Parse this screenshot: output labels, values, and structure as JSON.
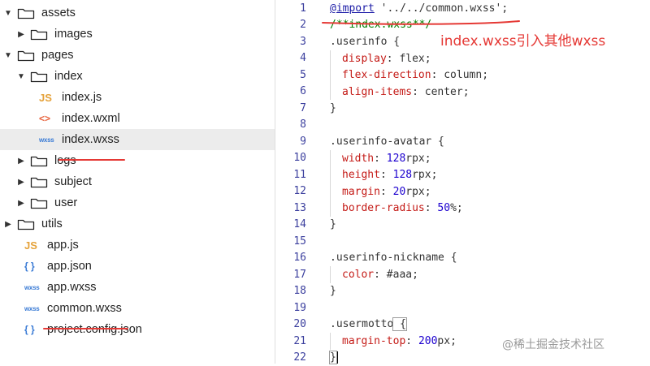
{
  "tree": {
    "items": [
      {
        "id": "assets",
        "label": "assets",
        "type": "folder",
        "expanded": true
      },
      {
        "id": "images",
        "label": "images",
        "type": "folder",
        "expanded": false
      },
      {
        "id": "pages",
        "label": "pages",
        "type": "folder",
        "expanded": true
      },
      {
        "id": "index",
        "label": "index",
        "type": "folder",
        "expanded": true
      },
      {
        "id": "index-js",
        "label": "index.js",
        "type": "file",
        "icon": "JS"
      },
      {
        "id": "index-wxml",
        "label": "index.wxml",
        "type": "file",
        "icon": "<>"
      },
      {
        "id": "index-wxss",
        "label": "index.wxss",
        "type": "file",
        "icon": "wxss",
        "selected": true
      },
      {
        "id": "logs",
        "label": "logs",
        "type": "folder",
        "expanded": false
      },
      {
        "id": "subject",
        "label": "subject",
        "type": "folder",
        "expanded": false
      },
      {
        "id": "user",
        "label": "user",
        "type": "folder",
        "expanded": false
      },
      {
        "id": "utils",
        "label": "utils",
        "type": "folder",
        "expanded": false
      },
      {
        "id": "app-js",
        "label": "app.js",
        "type": "file",
        "icon": "JS"
      },
      {
        "id": "app-json",
        "label": "app.json",
        "type": "file",
        "icon": "{ }"
      },
      {
        "id": "app-wxss",
        "label": "app.wxss",
        "type": "file",
        "icon": "wxss"
      },
      {
        "id": "common-wxss",
        "label": "common.wxss",
        "type": "file",
        "icon": "wxss"
      },
      {
        "id": "project-config",
        "label": "project.config.json",
        "type": "file",
        "icon": "{ }"
      }
    ]
  },
  "editor": {
    "lines": [
      {
        "n": "1",
        "tokens": [
          [
            "at",
            "@import"
          ],
          [
            "str",
            " '../../common.wxss'"
          ],
          [
            "punc",
            ";"
          ]
        ]
      },
      {
        "n": "2",
        "tokens": [
          [
            "comment",
            "/**index.wxss**/"
          ]
        ]
      },
      {
        "n": "3",
        "tokens": [
          [
            "sel",
            ".userinfo"
          ],
          [
            "punc",
            " {"
          ]
        ]
      },
      {
        "n": "4",
        "tokens": [
          [
            "ind",
            ""
          ],
          [
            "prop",
            "display"
          ],
          [
            "punc",
            ": "
          ],
          [
            "val",
            "flex"
          ],
          [
            "punc",
            ";"
          ]
        ]
      },
      {
        "n": "5",
        "tokens": [
          [
            "ind",
            ""
          ],
          [
            "prop",
            "flex-direction"
          ],
          [
            "punc",
            ": "
          ],
          [
            "val",
            "column"
          ],
          [
            "punc",
            ";"
          ]
        ]
      },
      {
        "n": "6",
        "tokens": [
          [
            "ind",
            ""
          ],
          [
            "prop",
            "align-items"
          ],
          [
            "punc",
            ": "
          ],
          [
            "val",
            "center"
          ],
          [
            "punc",
            ";"
          ]
        ]
      },
      {
        "n": "7",
        "tokens": [
          [
            "punc",
            "}"
          ]
        ]
      },
      {
        "n": "8",
        "tokens": []
      },
      {
        "n": "9",
        "tokens": [
          [
            "sel",
            ".userinfo-avatar"
          ],
          [
            "punc",
            " {"
          ]
        ]
      },
      {
        "n": "10",
        "tokens": [
          [
            "ind",
            ""
          ],
          [
            "prop",
            "width"
          ],
          [
            "punc",
            ": "
          ],
          [
            "num",
            "128"
          ],
          [
            "val",
            "rpx"
          ],
          [
            "punc",
            ";"
          ]
        ]
      },
      {
        "n": "11",
        "tokens": [
          [
            "ind",
            ""
          ],
          [
            "prop",
            "height"
          ],
          [
            "punc",
            ": "
          ],
          [
            "num",
            "128"
          ],
          [
            "val",
            "rpx"
          ],
          [
            "punc",
            ";"
          ]
        ]
      },
      {
        "n": "12",
        "tokens": [
          [
            "ind",
            ""
          ],
          [
            "prop",
            "margin"
          ],
          [
            "punc",
            ": "
          ],
          [
            "num",
            "20"
          ],
          [
            "val",
            "rpx"
          ],
          [
            "punc",
            ";"
          ]
        ]
      },
      {
        "n": "13",
        "tokens": [
          [
            "ind",
            ""
          ],
          [
            "prop",
            "border-radius"
          ],
          [
            "punc",
            ": "
          ],
          [
            "num",
            "50"
          ],
          [
            "val",
            "%"
          ],
          [
            "punc",
            ";"
          ]
        ]
      },
      {
        "n": "14",
        "tokens": [
          [
            "punc",
            "}"
          ]
        ]
      },
      {
        "n": "15",
        "tokens": []
      },
      {
        "n": "16",
        "tokens": [
          [
            "sel",
            ".userinfo-nickname"
          ],
          [
            "punc",
            " {"
          ]
        ]
      },
      {
        "n": "17",
        "tokens": [
          [
            "ind",
            ""
          ],
          [
            "prop",
            "color"
          ],
          [
            "punc",
            ": "
          ],
          [
            "hex",
            "#aaa"
          ],
          [
            "punc",
            ";"
          ]
        ]
      },
      {
        "n": "18",
        "tokens": [
          [
            "punc",
            "}"
          ]
        ]
      },
      {
        "n": "19",
        "tokens": []
      },
      {
        "n": "20",
        "tokens": [
          [
            "sel",
            ".usermotto"
          ],
          [
            "bracket",
            " {"
          ]
        ]
      },
      {
        "n": "21",
        "tokens": [
          [
            "ind",
            ""
          ],
          [
            "prop",
            "margin-top"
          ],
          [
            "punc",
            ": "
          ],
          [
            "num",
            "200"
          ],
          [
            "val",
            "px"
          ],
          [
            "punc",
            ";"
          ]
        ]
      },
      {
        "n": "22",
        "tokens": [
          [
            "bracket",
            "}"
          ],
          [
            "cursor",
            ""
          ]
        ]
      }
    ]
  },
  "annotation": "index.wxss引入其他wxss",
  "watermark": "@稀土掘金技术社区",
  "colors": {
    "underline": "#e53935",
    "selected_row": "#ececec",
    "line_numbers": "#3b3f9e",
    "property": "#c41a16",
    "number": "#1c00cf",
    "comment": "#008000"
  }
}
